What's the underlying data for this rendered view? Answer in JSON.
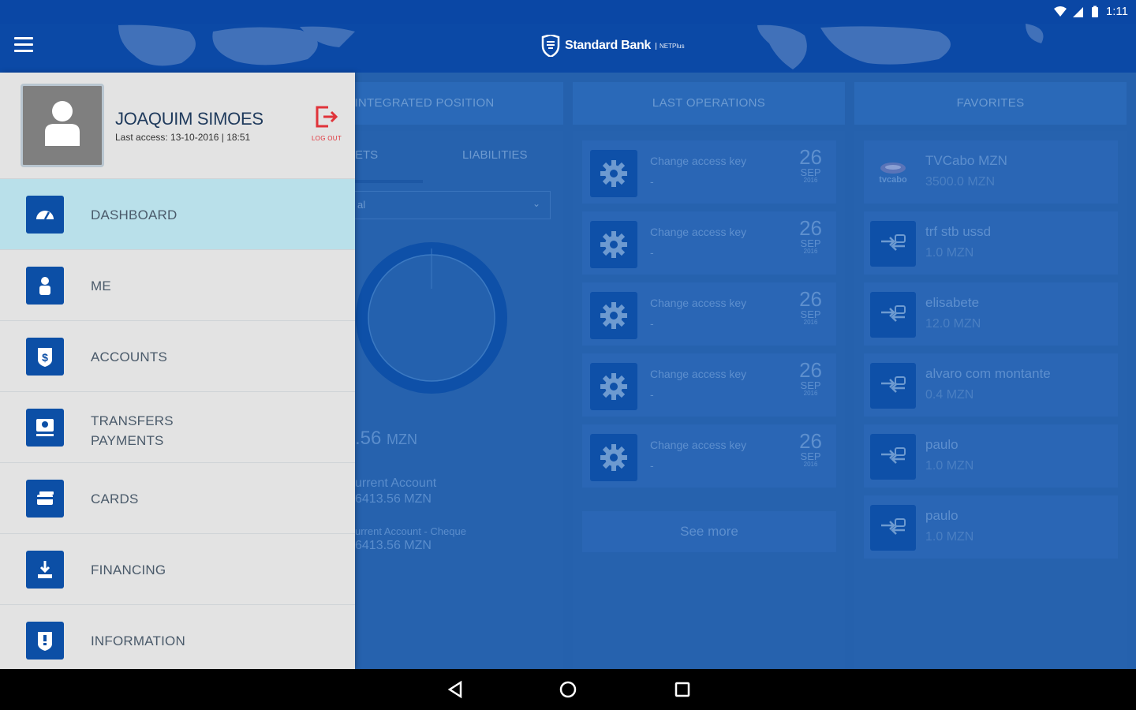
{
  "status_bar": {
    "time": "1:11"
  },
  "app_bar": {
    "brand_name": "Standard Bank",
    "brand_sub": "NETPlus"
  },
  "columns": {
    "integrated_position": {
      "title": "INTEGRATED POSITION",
      "tabs": [
        "ETS",
        "LIABILITIES"
      ],
      "dropdown_value": "al",
      "total_amount": ".56",
      "total_currency": "MZN",
      "accounts": [
        {
          "name": "urrent Account",
          "value": "6413.56 MZN"
        },
        {
          "name": "urrent Account - Cheque",
          "value": "6413.56 MZN"
        }
      ]
    },
    "last_operations": {
      "title": "LAST OPERATIONS",
      "items": [
        {
          "title": "Change access key",
          "sub": "-",
          "day": "26",
          "month": "SEP",
          "year": "2016"
        },
        {
          "title": "Change access key",
          "sub": "-",
          "day": "26",
          "month": "SEP",
          "year": "2016"
        },
        {
          "title": "Change access key",
          "sub": "-",
          "day": "26",
          "month": "SEP",
          "year": "2016"
        },
        {
          "title": "Change access key",
          "sub": "-",
          "day": "26",
          "month": "SEP",
          "year": "2016"
        },
        {
          "title": "Change access key",
          "sub": "-",
          "day": "26",
          "month": "SEP",
          "year": "2016"
        }
      ],
      "see_more": "See more"
    },
    "favorites": {
      "title": "FAVORITES",
      "items": [
        {
          "name": "TVCabo MZN",
          "amount": "3500.0 MZN",
          "logo": "tvcabo"
        },
        {
          "name": "trf stb ussd",
          "amount": "1.0 MZN"
        },
        {
          "name": "elisabete",
          "amount": "12.0 MZN"
        },
        {
          "name": "alvaro com montante",
          "amount": "0.4 MZN"
        },
        {
          "name": "paulo",
          "amount": "1.0 MZN"
        },
        {
          "name": "paulo",
          "amount": "1.0 MZN"
        }
      ]
    }
  },
  "drawer": {
    "user_name": "JOAQUIM SIMOES",
    "last_access": "Last access:  13-10-2016 | 18:51",
    "logout_label": "LOG OUT",
    "menu": [
      {
        "label": "DASHBOARD",
        "icon": "gauge-icon",
        "active": true
      },
      {
        "label": "ME",
        "icon": "person-icon"
      },
      {
        "label": "ACCOUNTS",
        "icon": "dollar-shield-icon"
      },
      {
        "label_line1": "TRANSFERS",
        "label_line2": "PAYMENTS",
        "icon": "transfer-icon"
      },
      {
        "label": "CARDS",
        "icon": "cards-icon"
      },
      {
        "label": "FINANCING",
        "icon": "financing-icon"
      },
      {
        "label": "INFORMATION",
        "icon": "info-shield-icon"
      }
    ]
  },
  "colors": {
    "primary": "#0b49a6",
    "drawer_bg": "#e3e3e3",
    "active_item": "#b9e0ea",
    "icon_bg": "#0c4fa6",
    "logout": "#e0333a"
  }
}
